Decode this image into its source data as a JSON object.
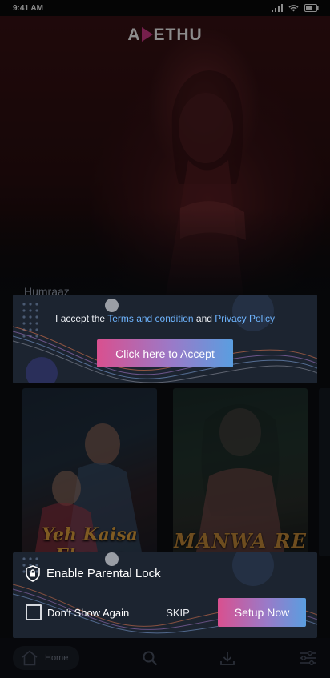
{
  "status_bar": {
    "time": "9:41 AM",
    "icons": [
      "signal-icon",
      "wifi-icon",
      "battery-icon"
    ]
  },
  "app": {
    "logo_left": "A",
    "logo_right": "ETHU",
    "logo_mark": "play-icon",
    "brand_color": "#d63a8a"
  },
  "content": {
    "row_title": "Humraaz",
    "thumbnails": [
      {
        "title_line1": "Yeh Kaisa",
        "title_line2": "Ehsaas"
      },
      {
        "title": "MANWA RE"
      }
    ]
  },
  "accept_dialog": {
    "prefix": "I accept the ",
    "terms_link": "Terms and condition",
    "middle": " and ",
    "privacy_link": "Privacy Policy",
    "button_label": "Click here to Accept",
    "link_color": "#6fb5ff"
  },
  "parental_dialog": {
    "title": "Enable Parental Lock",
    "icon": "shield-lock-icon",
    "checkbox_label": "Don't Show Again",
    "checkbox_checked": false,
    "skip_label": "SKIP",
    "setup_label": "Setup Now",
    "button_gradient": [
      "#d9508f",
      "#9a7ac8",
      "#5a9ee0"
    ]
  },
  "bottom_nav": {
    "home_label": "Home",
    "items": [
      "home-icon",
      "search-icon",
      "download-icon",
      "settings-sliders-icon"
    ]
  }
}
